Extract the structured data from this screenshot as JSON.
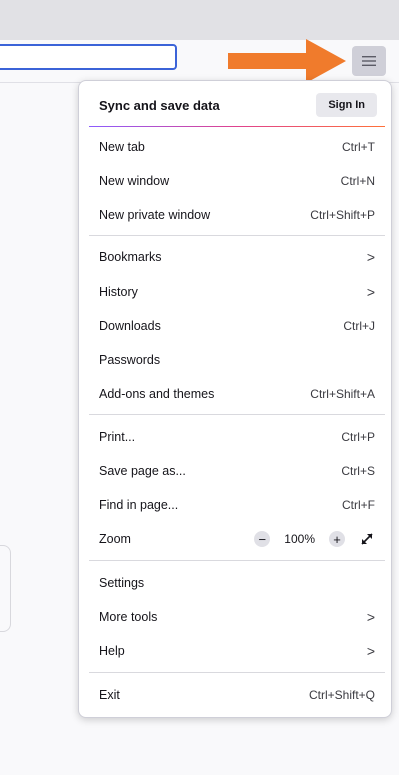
{
  "menu": {
    "sync_label": "Sync and save data",
    "sign_in": "Sign In",
    "items": [
      {
        "label": "New tab",
        "shortcut": "Ctrl+T"
      },
      {
        "label": "New window",
        "shortcut": "Ctrl+N"
      },
      {
        "label": "New private window",
        "shortcut": "Ctrl+Shift+P"
      },
      {
        "label": "Bookmarks",
        "chevron": ">"
      },
      {
        "label": "History",
        "chevron": ">"
      },
      {
        "label": "Downloads",
        "shortcut": "Ctrl+J"
      },
      {
        "label": "Passwords"
      },
      {
        "label": "Add-ons and themes",
        "shortcut": "Ctrl+Shift+A"
      },
      {
        "label": "Print...",
        "shortcut": "Ctrl+P"
      },
      {
        "label": "Save page as...",
        "shortcut": "Ctrl+S"
      },
      {
        "label": "Find in page...",
        "shortcut": "Ctrl+F"
      },
      {
        "label": "Settings"
      },
      {
        "label": "More tools",
        "chevron": ">"
      },
      {
        "label": "Help",
        "chevron": ">"
      },
      {
        "label": "Exit",
        "shortcut": "Ctrl+Shift+Q"
      }
    ],
    "zoom": {
      "label": "Zoom",
      "minus": "−",
      "value": "100%",
      "plus": "+"
    }
  },
  "icons": {
    "menu": "hamburger-icon",
    "fullscreen": "fullscreen-icon",
    "arrow": "orange-arrow-annotation"
  },
  "colors": {
    "arrow": "#f07b2c",
    "accent_blue": "#3b63d8",
    "menu_button_bg": "#cfcfd8"
  }
}
